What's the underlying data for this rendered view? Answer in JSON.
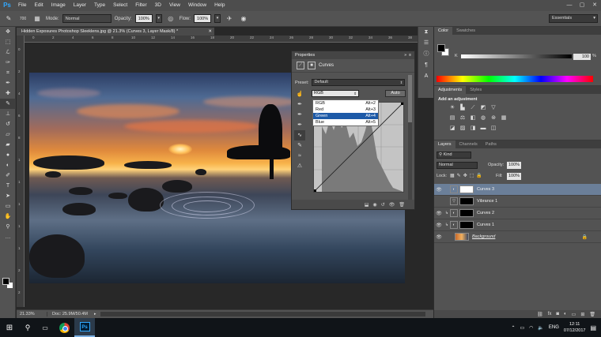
{
  "app": {
    "logo": "Ps",
    "menu": [
      "File",
      "Edit",
      "Image",
      "Layer",
      "Type",
      "Select",
      "Filter",
      "3D",
      "View",
      "Window",
      "Help"
    ],
    "window_controls": [
      "—",
      "▢",
      "✕"
    ]
  },
  "options_bar": {
    "brush_size": "700",
    "mode_label": "Mode:",
    "mode_value": "Normal",
    "opacity_label": "Opacity:",
    "opacity_value": "100%",
    "flow_label": "Flow:",
    "flow_value": "100%",
    "workspace": "Essentials"
  },
  "document": {
    "tab_title": "Hidden Exposures Photoshop Sleeklens.jpg @ 21.3% (Curves 3, Layer Mask/8) *",
    "ruler_top": [
      "0",
      "2",
      "4",
      "6",
      "8",
      "10",
      "12",
      "14",
      "16",
      "18",
      "20",
      "22",
      "24",
      "26",
      "28",
      "30",
      "32",
      "34",
      "36",
      "38"
    ],
    "ruler_left": [
      "0",
      "2",
      "4",
      "6",
      "8",
      "1",
      "1",
      "1",
      "1",
      "1",
      "2",
      "2"
    ]
  },
  "status": {
    "zoom": "21.33%",
    "doc_info": "Doc: 25.9M/50.4M"
  },
  "properties": {
    "header": "Properties",
    "title": "Curves",
    "preset_label": "Preset:",
    "preset_value": "Default",
    "channel_value": "RGB",
    "auto_label": "Auto",
    "channels": [
      {
        "name": "RGB",
        "shortcut": "Alt+2"
      },
      {
        "name": "Red",
        "shortcut": "Alt+3"
      },
      {
        "name": "Green",
        "shortcut": "Alt+4"
      },
      {
        "name": "Blue",
        "shortcut": "Alt+5"
      }
    ],
    "selected_channel": "Green"
  },
  "color_panel": {
    "tabs": [
      "Color",
      "Swatches"
    ],
    "k_label": "K",
    "k_value": "100",
    "k_unit": "%"
  },
  "adjustments_panel": {
    "tabs": [
      "Adjustments",
      "Styles"
    ],
    "heading": "Add an adjustment"
  },
  "layers_panel": {
    "tabs": [
      "Layers",
      "Channels",
      "Paths"
    ],
    "filter_kind": "Kind",
    "blend_mode": "Normal",
    "opacity_label": "Opacity:",
    "opacity_value": "100%",
    "lock_label": "Lock:",
    "fill_label": "Fill:",
    "fill_value": "100%",
    "layers": [
      {
        "name": "Curves 3",
        "visible": true,
        "selected": true
      },
      {
        "name": "Vibrance 1",
        "visible": false,
        "selected": false
      },
      {
        "name": "Curves 2",
        "visible": true,
        "selected": false
      },
      {
        "name": "Curves 1",
        "visible": true,
        "selected": false
      },
      {
        "name": "Background",
        "visible": true,
        "selected": false
      }
    ]
  },
  "taskbar": {
    "language": "ENG",
    "time": "12:11",
    "date": "07/12/2017"
  }
}
